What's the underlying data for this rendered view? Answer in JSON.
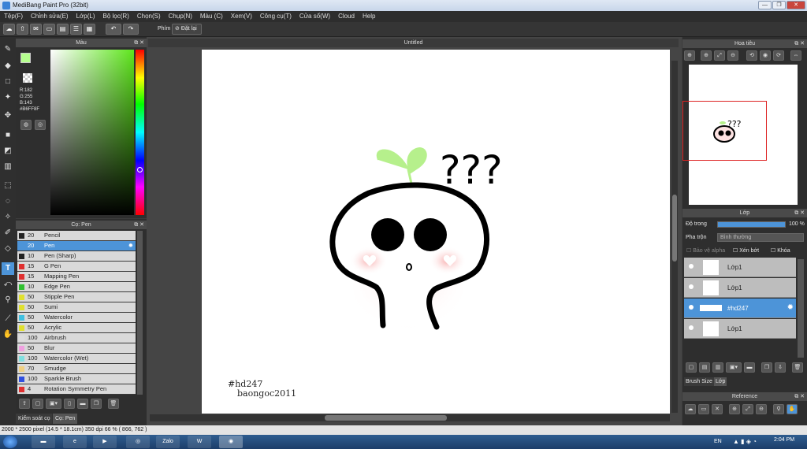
{
  "window": {
    "title": "MediBang Paint Pro (32bit)"
  },
  "menu": [
    "Tệp(F)",
    "Chỉnh sửa(E)",
    "Lớp(L)",
    "Bộ lọc(R)",
    "Chọn(S)",
    "Chụp(N)",
    "Màu (C)",
    "Xem(V)",
    "Công cụ(T)",
    "Cửa sổ(W)",
    "Cloud",
    "Help"
  ],
  "toolbar": {
    "key_label": "Phím",
    "reset_label": "Đặt lại"
  },
  "color_panel": {
    "title": "Màu",
    "r": "R:182",
    "g": "G:255",
    "b": "B:143",
    "hex": "#B6FF8F",
    "color": "#b6ff8f"
  },
  "brush_panel": {
    "title": "Cọ: Pen",
    "items": [
      {
        "size": "20",
        "name": "Pencil",
        "color": "#222222"
      },
      {
        "size": "20",
        "name": "Pen",
        "color": "#4d94d8"
      },
      {
        "size": "10",
        "name": "Pen (Sharp)",
        "color": "#222222"
      },
      {
        "size": "15",
        "name": "G Pen",
        "color": "#e03030"
      },
      {
        "size": "15",
        "name": "Mapping Pen",
        "color": "#e03030"
      },
      {
        "size": "10",
        "name": "Edge Pen",
        "color": "#30c030"
      },
      {
        "size": "50",
        "name": "Stipple Pen",
        "color": "#e0e030"
      },
      {
        "size": "50",
        "name": "Sumi",
        "color": "#e0e030"
      },
      {
        "size": "50",
        "name": "Watercolor",
        "color": "#40c0e0"
      },
      {
        "size": "50",
        "name": "Acrylic",
        "color": "#e0e030"
      },
      {
        "size": "100",
        "name": "Airbrush",
        "color": "#dddddd"
      },
      {
        "size": "50",
        "name": "Blur",
        "color": "#f0a0e0"
      },
      {
        "size": "100",
        "name": "Watercolor (Wet)",
        "color": "#80e0e0"
      },
      {
        "size": "70",
        "name": "Smudge",
        "color": "#f0d080"
      },
      {
        "size": "100",
        "name": "Sparkle Brush",
        "color": "#3050e0"
      },
      {
        "size": "4",
        "name": "Rotation Symmetry Pen",
        "color": "#e03030"
      }
    ],
    "tab_control": "Kiểm soát cọ",
    "tab_brush": "Cọ: Pen"
  },
  "document": {
    "title": "Untitled",
    "signature_line1": "#hd247",
    "signature_line2": "baongoc2011"
  },
  "navigator": {
    "title": "Hoa tiêu"
  },
  "layer_panel": {
    "title": "Lớp",
    "opacity_label": "Độ trong",
    "opacity_value": "100 %",
    "opacity_fraction": 1.0,
    "blend_label": "Pha trộn",
    "blend_value": "Bình thường",
    "protect_alpha": "Bảo vệ alpha",
    "clipping": "Xén bớt",
    "lock": "Khóa",
    "layers": [
      {
        "name": "Lớp1"
      },
      {
        "name": "Lớp1"
      },
      {
        "name": "#hd247"
      },
      {
        "name": "Lớp1"
      }
    ],
    "tab_brush_size": "Brush Size",
    "tab_layer": "Lớp"
  },
  "reference": {
    "title": "Reference"
  },
  "status": {
    "text": "2000 * 2500 pixel   (14.5 * 18.1cm)   350 dpi   66 %   ( 866, 762 )"
  },
  "taskbar": {
    "lang": "EN",
    "time": "2:04 PM",
    "apps": [
      "Zalo",
      "W"
    ]
  }
}
